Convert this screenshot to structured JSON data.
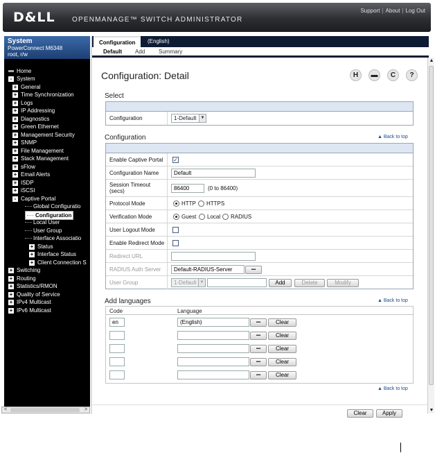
{
  "header": {
    "logo": "D&LL",
    "app_title": "OPENMANAGE™ SWITCH ADMINISTRATOR",
    "links": [
      "Support",
      "About",
      "Log Out"
    ]
  },
  "nav": {
    "system_title": "System",
    "device": "PowerConnect M6348",
    "user": "root, r/w",
    "items": [
      {
        "label": "Home",
        "box": ""
      },
      {
        "label": "System",
        "box": "-"
      },
      {
        "label": "General",
        "box": "+"
      },
      {
        "label": "Time Synchronization",
        "box": "+"
      },
      {
        "label": "Logs",
        "box": "+"
      },
      {
        "label": "IP Addressing",
        "box": "+"
      },
      {
        "label": "Diagnostics",
        "box": "+"
      },
      {
        "label": "Green Ethernet",
        "box": "+"
      },
      {
        "label": "Management Security",
        "box": "+"
      },
      {
        "label": "SNMP",
        "box": "+"
      },
      {
        "label": "File Management",
        "box": "+"
      },
      {
        "label": "Stack Management",
        "box": "+"
      },
      {
        "label": "sFlow",
        "box": "+"
      },
      {
        "label": "Email Alerts",
        "box": "+"
      },
      {
        "label": "ISDP",
        "box": "+"
      },
      {
        "label": "iSCSI",
        "box": "+"
      },
      {
        "label": "Captive Portal",
        "box": "-"
      },
      {
        "label": "Global Configuratio",
        "box": ""
      },
      {
        "label": "Configuration",
        "box": ""
      },
      {
        "label": "Local User",
        "box": ""
      },
      {
        "label": "User Group",
        "box": ""
      },
      {
        "label": "Interface Associatio",
        "box": ""
      },
      {
        "label": "Status",
        "box": "+"
      },
      {
        "label": "Interface Status",
        "box": "+"
      },
      {
        "label": "Client Connection S",
        "box": "+"
      },
      {
        "label": "Switching",
        "box": "+"
      },
      {
        "label": "Routing",
        "box": "+"
      },
      {
        "label": "Statistics/RMON",
        "box": "+"
      },
      {
        "label": "Quality of Service",
        "box": "+"
      },
      {
        "label": "IPv4 Multicast",
        "box": "+"
      },
      {
        "label": "IPv6 Multicast",
        "box": "+"
      }
    ]
  },
  "tabs": [
    "Configuration",
    "(English)"
  ],
  "subtabs": [
    "Default",
    "Add",
    "Summary"
  ],
  "page_title": "Configuration: Detail",
  "toolbar_icons": [
    "save-icon",
    "print-icon",
    "refresh-icon",
    "help-icon"
  ],
  "toolbar_glyphs": [
    "H",
    "▬",
    "C",
    "?"
  ],
  "select_section": {
    "title": "Select",
    "label": "Configuration",
    "value": "1-Default"
  },
  "config_section": {
    "title": "Configuration",
    "back": "▲ Back to top",
    "enable_captive_portal": {
      "label": "Enable Captive Portal",
      "checked": "✓"
    },
    "configuration_name": {
      "label": "Configuration Name",
      "value": "Default"
    },
    "session_timeout": {
      "label1": "Session Timeout",
      "label2": "(secs)",
      "value": "86400",
      "hint": "(0 to 86400)"
    },
    "protocol_mode": {
      "label": "Protocol Mode",
      "options": [
        "HTTP",
        "HTTPS"
      ]
    },
    "verification_mode": {
      "label": "Verification Mode",
      "options": [
        "Guest",
        "Local",
        "RADIUS"
      ]
    },
    "user_logout_mode": {
      "label": "User Logout Mode"
    },
    "enable_redirect_mode": {
      "label": "Enable Redirect Mode"
    },
    "redirect_url": {
      "label": "Redirect URL",
      "value": ""
    },
    "radius_auth_server": {
      "label": "RADIUS Auth Server",
      "value": "Default-RADIUS-Server",
      "button": "▪▪▪"
    },
    "user_group": {
      "label": "User Group",
      "value": "1-Default",
      "buttons": [
        "Add",
        "Delete",
        "Modify"
      ]
    }
  },
  "languages_section": {
    "title": "Add languages",
    "back": "▲ Back to top",
    "col_code": "Code",
    "col_language": "Language",
    "rows": [
      {
        "code": "en",
        "language": "(English)",
        "browse": "▪▪▪",
        "clear": "Clear"
      },
      {
        "code": "",
        "language": "",
        "browse": "▪▪▪",
        "clear": "Clear"
      },
      {
        "code": "",
        "language": "",
        "browse": "▪▪▪",
        "clear": "Clear"
      },
      {
        "code": "",
        "language": "",
        "browse": "▪▪▪",
        "clear": "Clear"
      },
      {
        "code": "",
        "language": "",
        "browse": "▪▪▪",
        "clear": "Clear"
      }
    ],
    "back_bottom": "▲ Back to top"
  },
  "footer_buttons": [
    "Clear",
    "Apply"
  ]
}
